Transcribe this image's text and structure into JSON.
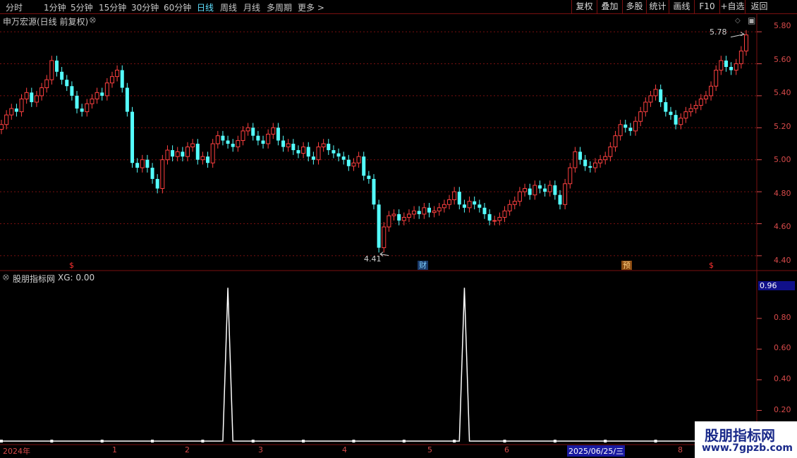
{
  "periods": [
    "分时",
    "1分钟",
    "5分钟",
    "15分钟",
    "30分钟",
    "60分钟",
    "日线",
    "周线",
    "月线",
    "多周期",
    "更多 >"
  ],
  "active_period": "日线",
  "toolbar": [
    "复权",
    "叠加",
    "多股",
    "统计",
    "画线",
    "F10",
    "+自选",
    "返回"
  ],
  "main_title": "申万宏源(日线 前复权)",
  "main_axis": [
    "5.80",
    "5.60",
    "5.40",
    "5.20",
    "5.00",
    "4.80",
    "4.60",
    "4.40"
  ],
  "high_label": "5.78",
  "low_label": "4.41",
  "badges": [
    {
      "text": "$",
      "color": "#ff3030"
    },
    {
      "text": "财",
      "color": "#7fd0ff"
    },
    {
      "text": "预",
      "color": "#ff9a30"
    },
    {
      "text": "$",
      "color": "#ff3030"
    }
  ],
  "indicator_title": "股朋指标网",
  "indicator_value": "XG: 0.00",
  "indicator_axis": [
    "0.96",
    "0.80",
    "0.60",
    "0.40",
    "0.20"
  ],
  "date_ticks": [
    "2024年",
    "1",
    "2",
    "3",
    "4",
    "5",
    "6",
    "7",
    "2025/06/25/三",
    "8"
  ],
  "watermark": {
    "title": "股朋指标网",
    "url": "www.7gpzb.com"
  },
  "colors": {
    "up": "#ff4040",
    "down": "#54ffff",
    "grid": "#7a1010",
    "axis": "#d84a4a"
  },
  "chart_data": [
    {
      "type": "candlestick",
      "title": "申万宏源(日线 前复权)",
      "ylim": [
        4.36,
        5.84
      ],
      "high_marker": 5.78,
      "low_marker": 4.41,
      "close": [
        5.22,
        5.28,
        5.32,
        5.3,
        5.38,
        5.42,
        5.36,
        5.4,
        5.45,
        5.5,
        5.62,
        5.55,
        5.5,
        5.46,
        5.4,
        5.32,
        5.3,
        5.35,
        5.38,
        5.42,
        5.4,
        5.48,
        5.52,
        5.56,
        5.45,
        5.3,
        4.98,
        4.95,
        5.0,
        4.95,
        4.88,
        4.82,
        5.0,
        5.06,
        5.02,
        5.05,
        5.02,
        5.08,
        5.1,
        5.0,
        5.02,
        4.98,
        5.1,
        5.15,
        5.12,
        5.1,
        5.08,
        5.12,
        5.18,
        5.2,
        5.15,
        5.12,
        5.1,
        5.16,
        5.2,
        5.12,
        5.08,
        5.1,
        5.06,
        5.04,
        5.08,
        5.02,
        5.0,
        5.08,
        5.1,
        5.06,
        5.04,
        5.02,
        5.0,
        4.96,
        4.98,
        5.02,
        4.9,
        4.88,
        4.72,
        4.45,
        4.58,
        4.65,
        4.66,
        4.62,
        4.64,
        4.66,
        4.68,
        4.66,
        4.7,
        4.67,
        4.68,
        4.7,
        4.72,
        4.75,
        4.8,
        4.72,
        4.7,
        4.74,
        4.72,
        4.7,
        4.66,
        4.62,
        4.62,
        4.64,
        4.68,
        4.72,
        4.74,
        4.8,
        4.82,
        4.78,
        4.84,
        4.82,
        4.8,
        4.84,
        4.78,
        4.72,
        4.85,
        4.95,
        5.05,
        5.0,
        4.96,
        4.95,
        4.98,
        5.0,
        5.02,
        5.08,
        5.15,
        5.22,
        5.2,
        5.18,
        5.24,
        5.3,
        5.36,
        5.4,
        5.44,
        5.36,
        5.3,
        5.28,
        5.22,
        5.26,
        5.3,
        5.32,
        5.34,
        5.38,
        5.4,
        5.46,
        5.56,
        5.62,
        5.58,
        5.56,
        5.6,
        5.68,
        5.78
      ]
    },
    {
      "type": "line",
      "title": "股朋指标网",
      "series": [
        {
          "name": "XG",
          "spikes_at": [
            45,
            92
          ],
          "spike_value": 1,
          "base_value": 0
        }
      ],
      "ylim": [
        0,
        1.02
      ]
    }
  ]
}
